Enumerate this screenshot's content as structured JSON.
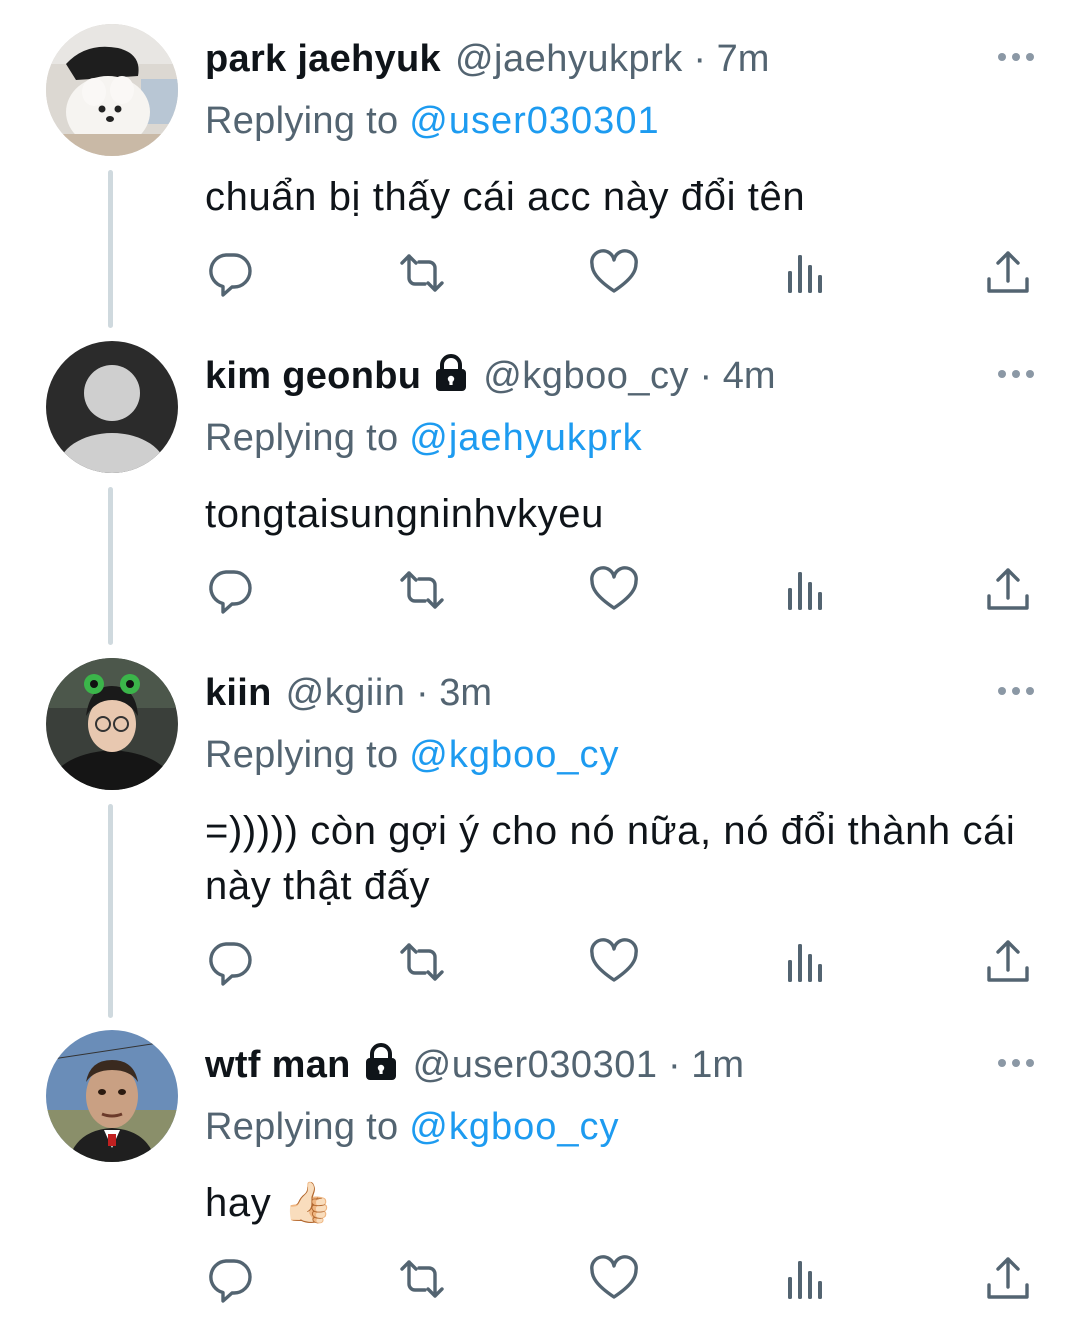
{
  "tweets": [
    {
      "name": "park jaehyuk",
      "locked": false,
      "handle": "@jaehyukprk",
      "separator": "·",
      "time": "7m",
      "reply_label": "Replying to",
      "reply_to": "@user030301",
      "text": "chuẩn bị thấy cái acc này đổi tên",
      "avatar": "dog-avatar"
    },
    {
      "name": "kim geonbu",
      "locked": true,
      "handle": "@kgboo_cy",
      "separator": "·",
      "time": "4m",
      "reply_label": "Replying to",
      "reply_to": "@jaehyukprk",
      "text": "tongtaisungninhvkyeu",
      "avatar": "default-avatar"
    },
    {
      "name": "kiin",
      "locked": false,
      "handle": "@kgiin",
      "separator": "·",
      "time": "3m",
      "reply_label": "Replying to",
      "reply_to": "@kgboo_cy",
      "text": "=))))) còn gợi ý cho nó nữa, nó đổi thành cái này thật đấy",
      "avatar": "person-avatar"
    },
    {
      "name": "wtf man",
      "locked": true,
      "handle": "@user030301",
      "separator": "·",
      "time": "1m",
      "reply_label": "Replying to",
      "reply_to": "@kgboo_cy",
      "text": "hay 👍🏻",
      "avatar": "man-avatar"
    }
  ],
  "icons": {
    "reply": "reply-icon",
    "retweet": "retweet-icon",
    "like": "heart-icon",
    "views": "views-icon",
    "share": "share-icon",
    "more": "more-icon",
    "lock": "lock-icon"
  },
  "colors": {
    "text": "#0f1419",
    "secondary": "#536471",
    "link": "#1d9bf0",
    "thread_line": "#cfd9de"
  }
}
